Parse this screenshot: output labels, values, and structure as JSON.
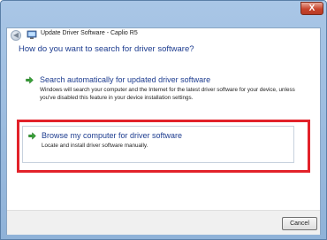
{
  "window": {
    "title": "Update Driver Software - Caplio R5",
    "close_glyph": "X"
  },
  "heading": "How do you want to search for driver software?",
  "options": [
    {
      "title": "Search automatically for updated driver software",
      "description": "Windows will search your computer and the Internet for the latest driver software for your device, unless you've disabled this feature in your device installation settings.",
      "icon": "green-arrow-icon"
    },
    {
      "title": "Browse my computer for driver software",
      "description": "Locate and install driver software manually.",
      "icon": "green-arrow-icon"
    }
  ],
  "buttons": {
    "cancel": "Cancel"
  },
  "colors": {
    "heading": "#1d3c8f",
    "highlight": "#e2222a",
    "arrow": "#3aa23a"
  }
}
